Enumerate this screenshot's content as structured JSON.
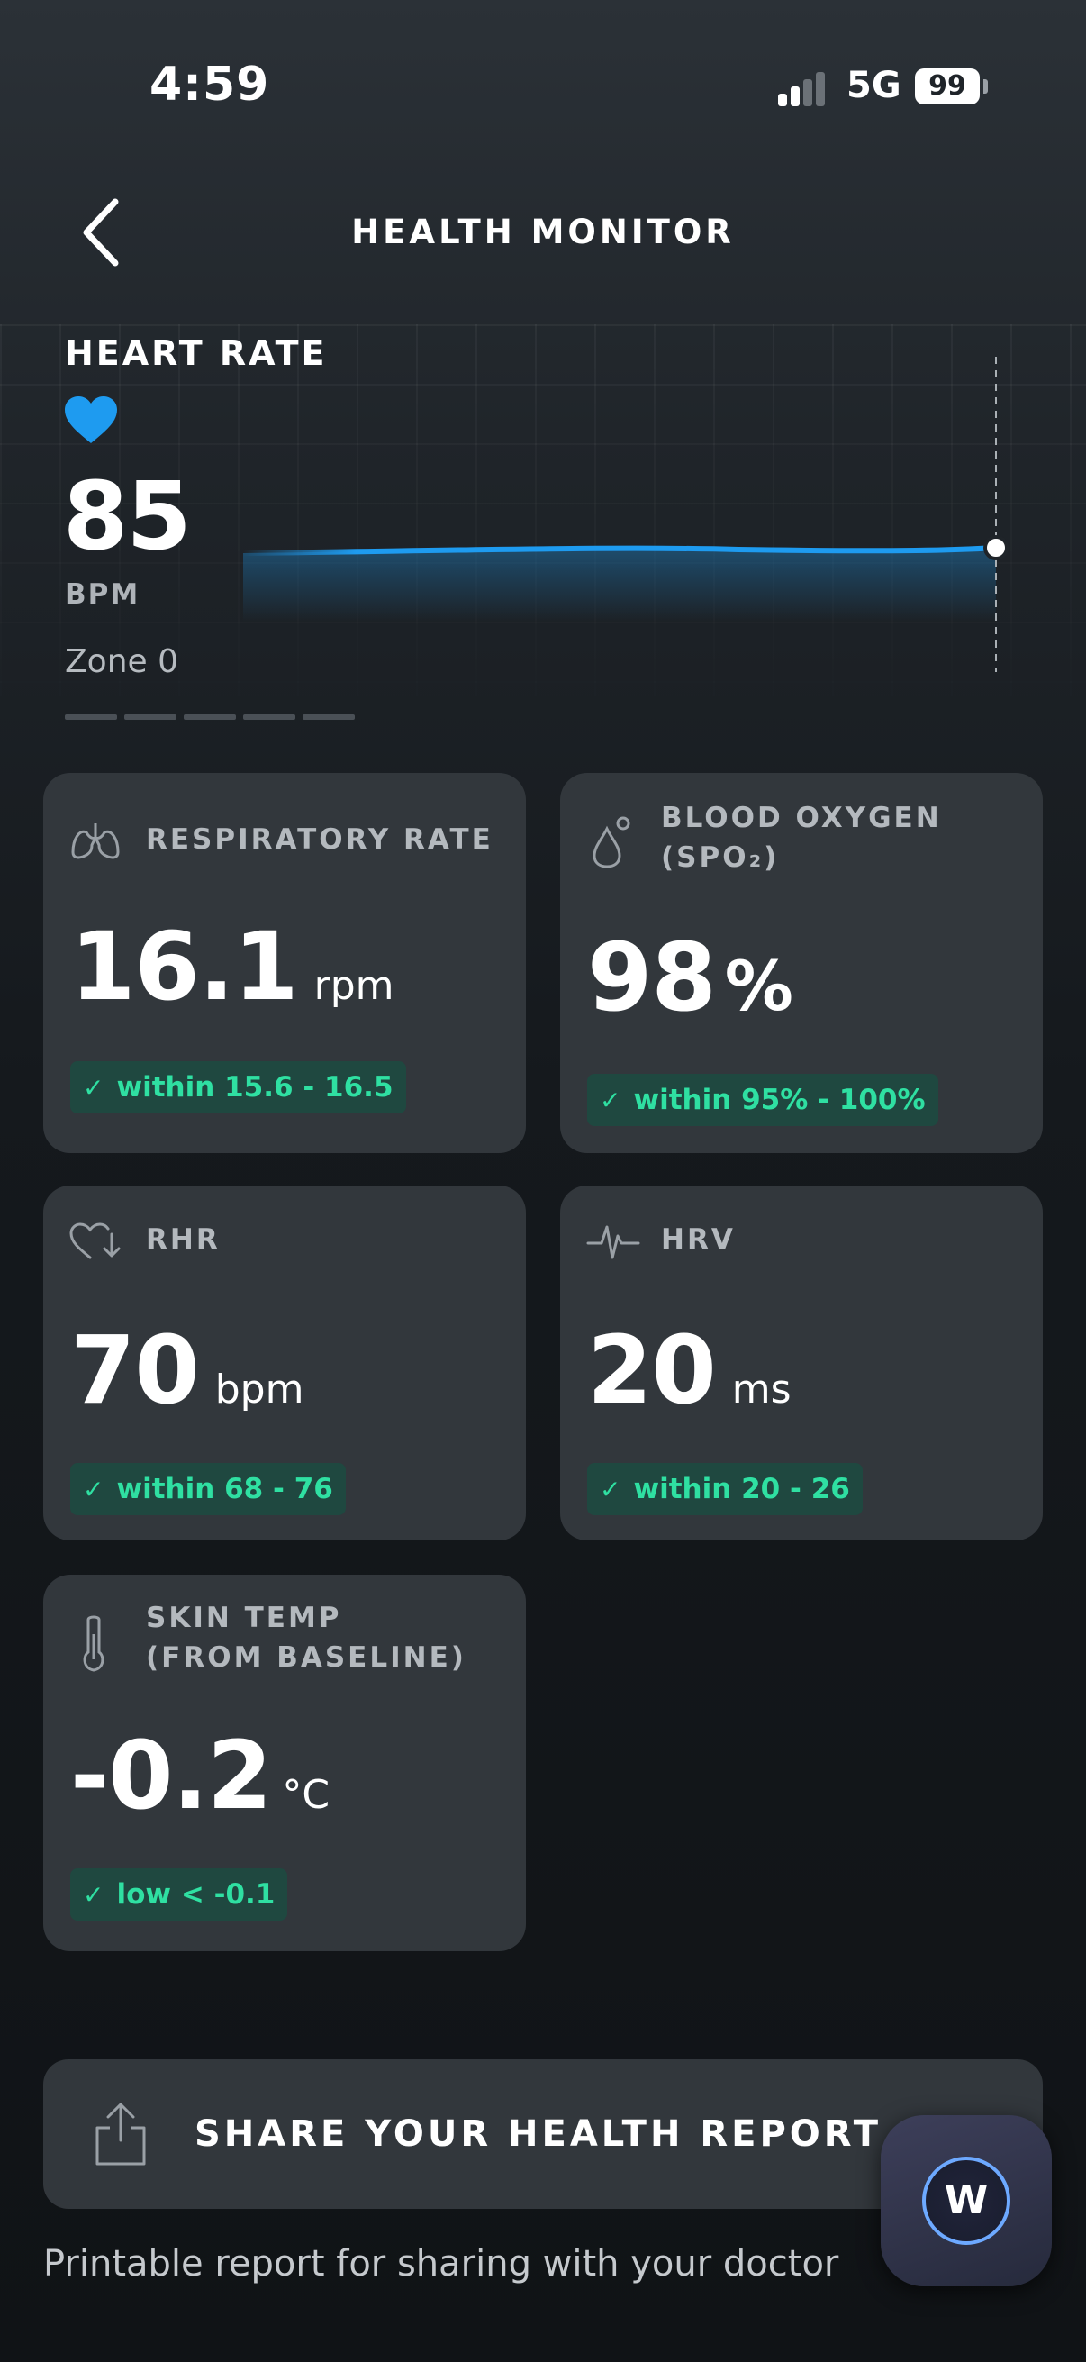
{
  "status_bar": {
    "time": "4:59",
    "network": "5G",
    "battery": "99"
  },
  "header": {
    "title": "HEALTH MONITOR"
  },
  "heart_rate": {
    "label": "HEART RATE",
    "value": "85",
    "unit": "BPM",
    "zone": "Zone 0",
    "line_color": "#1e9bf0",
    "heart_color": "#1e9bf0"
  },
  "cards": [
    {
      "icon": "lungs-icon",
      "title": "RESPIRATORY RATE",
      "value": "16.1",
      "unit": "rpm",
      "range": "within 15.6 - 16.5"
    },
    {
      "icon": "droplet-icon",
      "title_line1": "BLOOD OXYGEN",
      "title_line2": "(SPO₂)",
      "value": "98",
      "unit": "%",
      "range": "within 95% - 100%"
    },
    {
      "icon": "heart-down-icon",
      "title": "RHR",
      "value": "70",
      "unit": "bpm",
      "range": "within 68 - 76"
    },
    {
      "icon": "pulse-icon",
      "title": "HRV",
      "value": "20",
      "unit": "ms",
      "range": "within 20 - 26"
    },
    {
      "icon": "thermometer-icon",
      "title_line1": "SKIN TEMP",
      "title_line2": "(FROM BASELINE)",
      "value": "-0.2",
      "unit": "°C",
      "range": "low < -0.1"
    }
  ],
  "share": {
    "label": "SHARE YOUR HEALTH REPORT",
    "subtitle": "Printable report for sharing with your doctor"
  },
  "assistant": {
    "label": "W"
  },
  "colors": {
    "accent_green": "#2fe0a2",
    "pill_bg": "#1f4840",
    "card_bg": "#32373c"
  }
}
